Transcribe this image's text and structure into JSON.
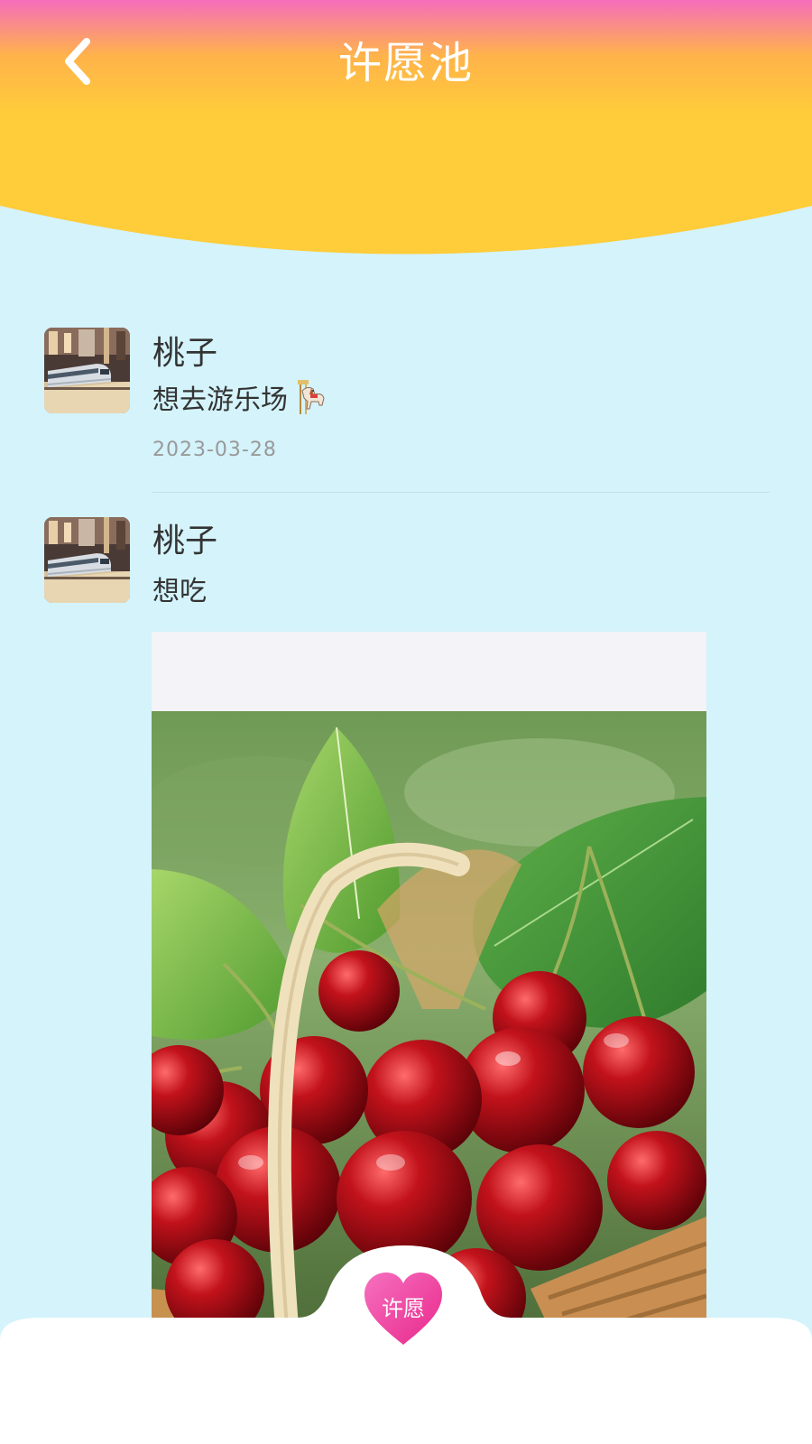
{
  "header": {
    "title": "许愿池",
    "back_icon": "chevron-left-icon",
    "colors": {
      "gradient_top": "#f56dbb",
      "gradient_bottom": "#ffcc3a"
    }
  },
  "wishes": [
    {
      "username": "桃子",
      "text": "想去游乐场",
      "emoji": "carousel-horse-icon",
      "date": "2023-03-28"
    },
    {
      "username": "桃子",
      "text": "想吃",
      "photo": "cherries-basket-image"
    }
  ],
  "bottom_bar": {
    "wish_button_label": "许愿",
    "wish_button_icon": "heart-icon",
    "colors": {
      "heart": "#ee3f9a"
    }
  }
}
